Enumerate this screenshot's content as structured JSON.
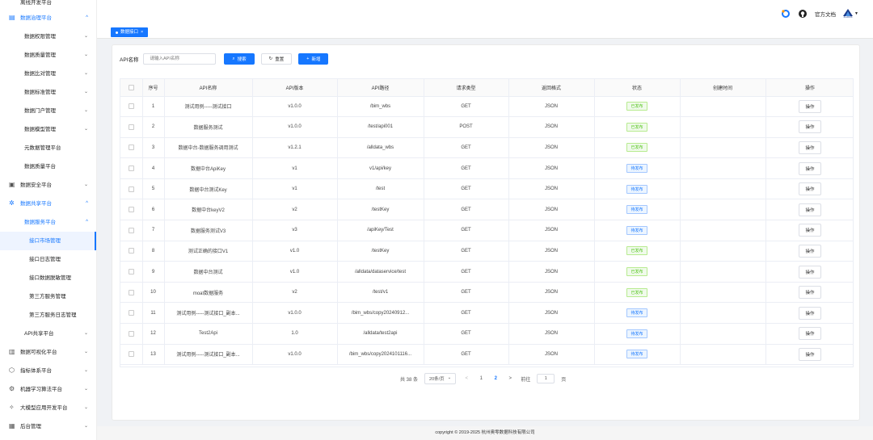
{
  "sidebar": {
    "items": [
      {
        "label": "离线开发平台",
        "level": 0,
        "icon": "",
        "chevron": "",
        "state": ""
      },
      {
        "label": "数据治理平台",
        "level": 0,
        "icon": "▤",
        "chevron": "^",
        "state": "blue"
      },
      {
        "label": "数据权限管理",
        "level": 1,
        "icon": "",
        "chevron": "⌄",
        "state": ""
      },
      {
        "label": "数据质量管理",
        "level": 1,
        "icon": "",
        "chevron": "⌄",
        "state": ""
      },
      {
        "label": "数据比对管理",
        "level": 1,
        "icon": "",
        "chevron": "⌄",
        "state": ""
      },
      {
        "label": "数据标准管理",
        "level": 1,
        "icon": "",
        "chevron": "⌄",
        "state": ""
      },
      {
        "label": "数据门户管理",
        "level": 1,
        "icon": "",
        "chevron": "⌄",
        "state": ""
      },
      {
        "label": "数据模型管理",
        "level": 1,
        "icon": "",
        "chevron": "⌄",
        "state": ""
      },
      {
        "label": "元数据管理平台",
        "level": 1,
        "icon": "",
        "chevron": "",
        "state": ""
      },
      {
        "label": "数据质量平台",
        "level": 1,
        "icon": "",
        "chevron": "",
        "state": ""
      },
      {
        "label": "数据安全平台",
        "level": 0,
        "icon": "▣",
        "chevron": "⌄",
        "state": ""
      },
      {
        "label": "数据共享平台",
        "level": 0,
        "icon": "✲",
        "chevron": "^",
        "state": "blue"
      },
      {
        "label": "数据服务平台",
        "level": 1,
        "icon": "",
        "chevron": "^",
        "state": "blue"
      },
      {
        "label": "接口市场管理",
        "level": 2,
        "icon": "",
        "chevron": "",
        "state": "active"
      },
      {
        "label": "接口日志管理",
        "level": 2,
        "icon": "",
        "chevron": "",
        "state": ""
      },
      {
        "label": "接口数据脱敏管理",
        "level": 2,
        "icon": "",
        "chevron": "",
        "state": ""
      },
      {
        "label": "第三方服务管理",
        "level": 2,
        "icon": "",
        "chevron": "",
        "state": ""
      },
      {
        "label": "第三方服务日志管理",
        "level": 2,
        "icon": "",
        "chevron": "",
        "state": ""
      },
      {
        "label": "API共享平台",
        "level": 1,
        "icon": "",
        "chevron": "⌄",
        "state": ""
      },
      {
        "label": "数据可视化平台",
        "level": 0,
        "icon": "▥",
        "chevron": "⌄",
        "state": ""
      },
      {
        "label": "指标体系平台",
        "level": 0,
        "icon": "⬡",
        "chevron": "⌄",
        "state": ""
      },
      {
        "label": "机器学习算法平台",
        "level": 0,
        "icon": "⚙",
        "chevron": "⌄",
        "state": ""
      },
      {
        "label": "大模型应用开发平台",
        "level": 0,
        "icon": "✧",
        "chevron": "⌄",
        "state": ""
      },
      {
        "label": "后台管理",
        "level": 0,
        "icon": "▦",
        "chevron": "⌄",
        "state": ""
      }
    ]
  },
  "header": {
    "docs_label": "官方文档",
    "user_logo_text": "ALLDATA",
    "user_chevron": "▼"
  },
  "tabs": {
    "active_tab": "数据接口",
    "close": "×"
  },
  "search": {
    "label": "API名称",
    "placeholder": "请输入API名称",
    "search_btn": "搜索",
    "reset_btn": "重置",
    "add_btn": "新增"
  },
  "table": {
    "headers": [
      "序号",
      "API名称",
      "API版本",
      "API路径",
      "请求类型",
      "返回格式",
      "状态",
      "创建时间",
      "操作"
    ],
    "op_label": "操作",
    "rows": [
      {
        "no": "1",
        "name": "测试用例-----测试接口",
        "version": "v1.0.0",
        "path": "/bim_wbs",
        "method": "GET",
        "format": "JSON",
        "status": "已发布",
        "status_type": "pub",
        "created": ""
      },
      {
        "no": "2",
        "name": "数据服务测试",
        "version": "v1.0.0",
        "path": "/test/api001",
        "method": "POST",
        "format": "JSON",
        "status": "已发布",
        "status_type": "pub",
        "created": ""
      },
      {
        "no": "3",
        "name": "数据中台-数据服务调用测试",
        "version": "v1.2.1",
        "path": "/alldata_wbs",
        "method": "GET",
        "format": "JSON",
        "status": "已发布",
        "status_type": "pub",
        "created": ""
      },
      {
        "no": "4",
        "name": "数据中台ApiKey",
        "version": "v1",
        "path": "v1/api/key",
        "method": "GET",
        "format": "JSON",
        "status": "待发布",
        "status_type": "unpub",
        "created": ""
      },
      {
        "no": "5",
        "name": "数据中台测试Key",
        "version": "v1",
        "path": "/test",
        "method": "GET",
        "format": "JSON",
        "status": "待发布",
        "status_type": "unpub",
        "created": ""
      },
      {
        "no": "6",
        "name": "数据中台keyV2",
        "version": "v2",
        "path": "/testKey",
        "method": "GET",
        "format": "JSON",
        "status": "待发布",
        "status_type": "unpub",
        "created": ""
      },
      {
        "no": "7",
        "name": "数据服务测试V3",
        "version": "v3",
        "path": "/apiKey/Test",
        "method": "GET",
        "format": "JSON",
        "status": "待发布",
        "status_type": "unpub",
        "created": ""
      },
      {
        "no": "8",
        "name": "测试正确的接口V1",
        "version": "v1.0",
        "path": "/testKey",
        "method": "GET",
        "format": "JSON",
        "status": "已发布",
        "status_type": "pub",
        "created": ""
      },
      {
        "no": "9",
        "name": "数据中台测试",
        "version": "v1.0",
        "path": "/alldata/dataservice/test",
        "method": "GET",
        "format": "JSON",
        "status": "已发布",
        "status_type": "pub",
        "created": ""
      },
      {
        "no": "10",
        "name": "moat数据服务",
        "version": "v2",
        "path": "/test/v1",
        "method": "GET",
        "format": "JSON",
        "status": "已发布",
        "status_type": "pub",
        "created": ""
      },
      {
        "no": "11",
        "name": "测试用例-----测试接口_副本...",
        "version": "v1.0.0",
        "path": "/bim_wbs/copy20240912...",
        "method": "GET",
        "format": "JSON",
        "status": "待发布",
        "status_type": "unpub",
        "created": ""
      },
      {
        "no": "12",
        "name": "Test2Api",
        "version": "1.0",
        "path": "/alldata/test2api",
        "method": "GET",
        "format": "JSON",
        "status": "待发布",
        "status_type": "unpub",
        "created": ""
      },
      {
        "no": "13",
        "name": "测试用例-----测试接口_副本...",
        "version": "v1.0.0",
        "path": "/bim_wbs/copy2024101116...",
        "method": "GET",
        "format": "JSON",
        "status": "待发布",
        "status_type": "unpub",
        "created": ""
      }
    ]
  },
  "pager": {
    "total": "共 38 条",
    "page_size": "20条/页",
    "prev": "<",
    "pages": [
      "1",
      "2"
    ],
    "current": "2",
    "next": ">",
    "goto_label": "前往",
    "goto_value": "1",
    "page_unit": "页"
  },
  "footer": {
    "copyright": "copyright © 2019-2025 杭州奥零数据科技有限公司"
  },
  "colors": {
    "accent": "#1677ff",
    "published": "#52c41a"
  }
}
